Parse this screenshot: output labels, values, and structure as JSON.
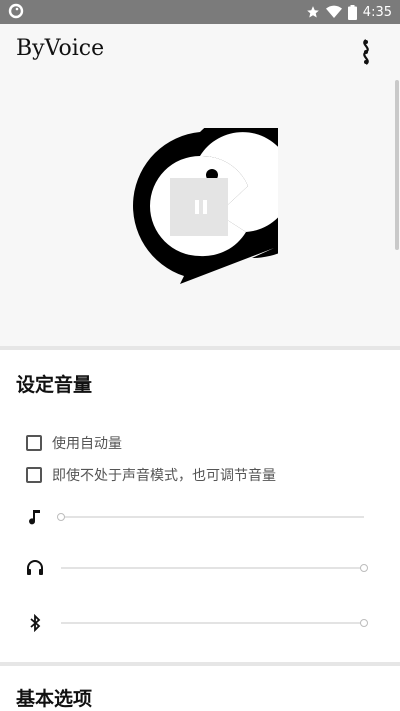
{
  "status_bar": {
    "time": "4:35",
    "icons": [
      "app-notification-icon",
      "star-icon",
      "wifi-icon",
      "battery-icon"
    ]
  },
  "app_bar": {
    "title": "ByVoice",
    "menu_icon": "overflow-menu-icon"
  },
  "hero": {
    "logo_icon": "byvoice-logo-icon",
    "center_icon": "pause-icon"
  },
  "volume_section": {
    "title": "设定音量",
    "options": [
      {
        "label": "使用自动量",
        "checked": false
      },
      {
        "label": "即使不处于声音模式，也可调节音量",
        "checked": false
      }
    ],
    "sliders": [
      {
        "icon": "music-note-icon",
        "value": 0
      },
      {
        "icon": "headphones-icon",
        "value": 1
      },
      {
        "icon": "bluetooth-icon",
        "value": 1
      }
    ]
  },
  "basic_section": {
    "title": "基本选项"
  }
}
